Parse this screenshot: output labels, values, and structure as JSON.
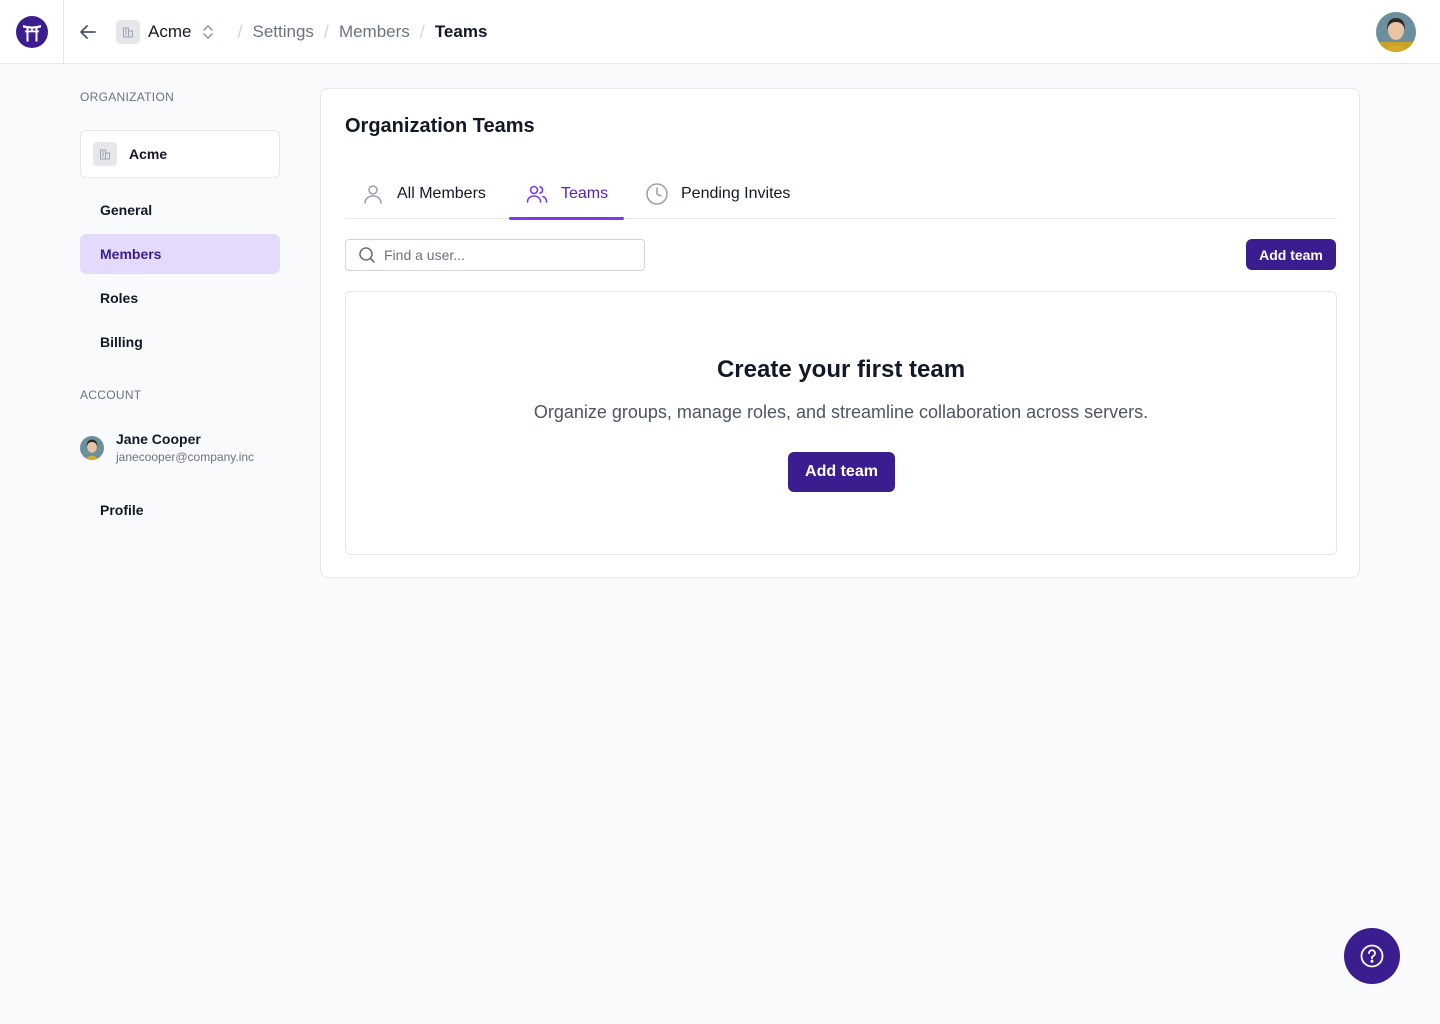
{
  "header": {
    "org_name": "Acme",
    "breadcrumbs": [
      "Settings",
      "Members",
      "Teams"
    ]
  },
  "sidebar": {
    "organization_heading": "ORGANIZATION",
    "org_select_label": "Acme",
    "items": [
      {
        "label": "General"
      },
      {
        "label": "Members",
        "active": true
      },
      {
        "label": "Roles"
      },
      {
        "label": "Billing"
      }
    ],
    "account_heading": "ACCOUNT",
    "user": {
      "name": "Jane Cooper",
      "email": "janecooper@company.inc"
    },
    "profile_label": "Profile"
  },
  "main": {
    "title": "Organization Teams",
    "tabs": [
      {
        "label": "All Members",
        "icon": "user-icon"
      },
      {
        "label": "Teams",
        "icon": "users-icon",
        "active": true
      },
      {
        "label": "Pending Invites",
        "icon": "clock-icon"
      }
    ],
    "search": {
      "placeholder": "Find a user..."
    },
    "add_team_label": "Add team",
    "empty_state": {
      "title": "Create your first team",
      "description": "Organize groups, manage roles, and streamline collaboration across servers.",
      "button_label": "Add team"
    }
  },
  "colors": {
    "brand": "#3b1d8f",
    "accent": "#7c3aed",
    "active_nav_bg": "#e4dafb"
  }
}
